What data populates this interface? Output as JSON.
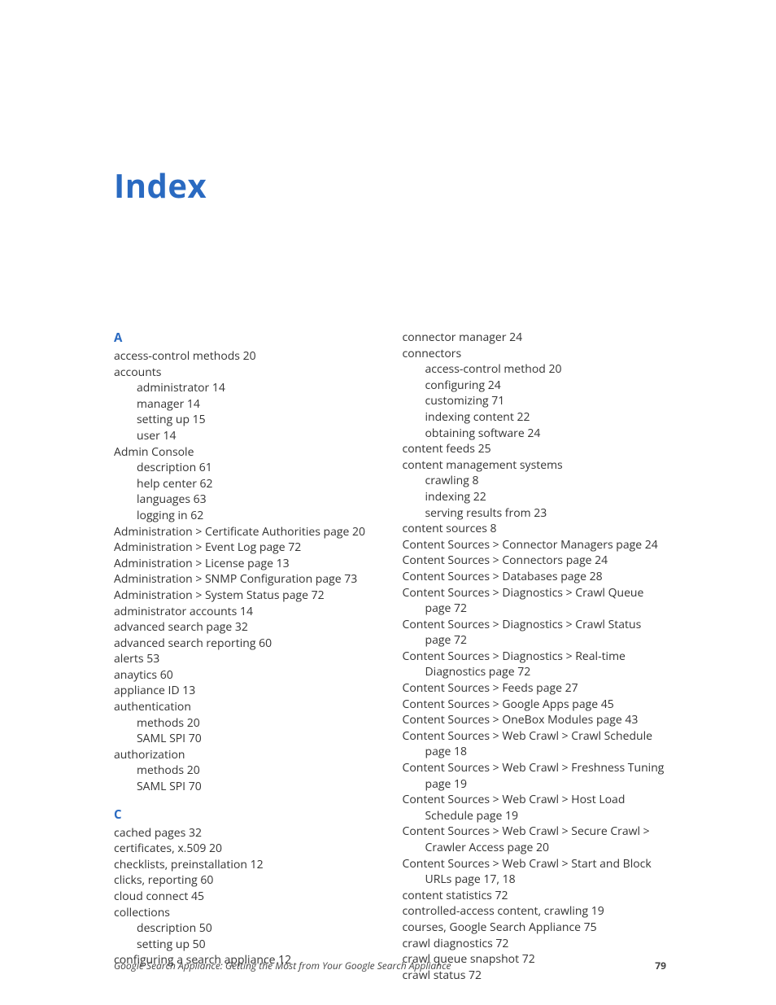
{
  "title": "Index",
  "footer": {
    "doc_title": "Google Search Appliance: Getting the Most from Your Google Search Appliance",
    "page_number": "79"
  },
  "sections": [
    {
      "letter": "A",
      "entries": [
        {
          "text": "access-control methods  20"
        },
        {
          "text": "accounts",
          "subs": [
            {
              "text": "administrator  14"
            },
            {
              "text": "manager  14"
            },
            {
              "text": "setting up  15"
            },
            {
              "text": "user  14"
            }
          ]
        },
        {
          "text": "Admin Console",
          "subs": [
            {
              "text": "description  61"
            },
            {
              "text": "help center  62"
            },
            {
              "text": "languages  63"
            },
            {
              "text": "logging in  62"
            }
          ]
        },
        {
          "text": "Administration > Certificate Authorities page  20"
        },
        {
          "text": "Administration > Event Log page  72"
        },
        {
          "text": "Administration > License page  13"
        },
        {
          "text": "Administration > SNMP Configuration page  73"
        },
        {
          "text": "Administration > System Status page  72"
        },
        {
          "text": "administrator accounts  14"
        },
        {
          "text": "advanced search page  32"
        },
        {
          "text": "advanced search reporting  60"
        },
        {
          "text": "alerts  53"
        },
        {
          "text": "anaytics  60"
        },
        {
          "text": "appliance ID  13"
        },
        {
          "text": "authentication",
          "subs": [
            {
              "text": "methods  20"
            },
            {
              "text": "SAML SPI  70"
            }
          ]
        },
        {
          "text": "authorization",
          "subs": [
            {
              "text": "methods  20"
            },
            {
              "text": "SAML SPI  70"
            }
          ]
        }
      ]
    },
    {
      "letter": "C",
      "entries": [
        {
          "text": "cached pages  32"
        },
        {
          "text": "certificates, x.509  20"
        },
        {
          "text": "checklists, preinstallation  12"
        },
        {
          "text": "clicks, reporting  60"
        },
        {
          "text": "cloud connect  45"
        },
        {
          "text": "collections",
          "subs": [
            {
              "text": "description  50"
            },
            {
              "text": "setting up  50"
            }
          ]
        },
        {
          "text": "configuring a search appliance  12"
        },
        {
          "text": "connector manager  24"
        },
        {
          "text": "connectors",
          "subs": [
            {
              "text": "access-control method  20"
            },
            {
              "text": "configuring  24"
            },
            {
              "text": "customizing  71"
            },
            {
              "text": "indexing content  22"
            },
            {
              "text": "obtaining software  24"
            }
          ]
        },
        {
          "text": "content feeds  25"
        },
        {
          "text": "content management systems",
          "subs": [
            {
              "text": "crawling  8"
            },
            {
              "text": "indexing  22"
            },
            {
              "text": "serving results from  23"
            }
          ]
        },
        {
          "text": "content sources  8"
        },
        {
          "text": "Content Sources > Connector Managers page  24"
        },
        {
          "text": "Content Sources > Connectors page  24"
        },
        {
          "text": "Content Sources > Databases page  28"
        },
        {
          "text": "Content Sources > Diagnostics > Crawl Queue page  72",
          "hang": true
        },
        {
          "text": "Content Sources > Diagnostics > Crawl Status page  72",
          "hang": true
        },
        {
          "text": "Content Sources > Diagnostics > Real-time Diagnostics page  72",
          "hang": true
        },
        {
          "text": "Content Sources > Feeds page  27"
        },
        {
          "text": "Content Sources > Google Apps page  45"
        },
        {
          "text": "Content Sources > OneBox Modules page  43"
        },
        {
          "text": "Content Sources > Web Crawl > Crawl Schedule page  18",
          "hang": true
        },
        {
          "text": "Content Sources > Web Crawl > Freshness Tuning page  19",
          "hang": true
        },
        {
          "text": "Content Sources > Web Crawl > Host Load Schedule page  19",
          "hang": true
        },
        {
          "text": "Content Sources > Web Crawl > Secure Crawl > Crawler Access page  20",
          "hang": true
        },
        {
          "text": "Content Sources > Web Crawl > Start and Block URLs page  17, 18",
          "hang": true
        },
        {
          "text": "content statistics  72"
        },
        {
          "text": "controlled-access content, crawling  19"
        },
        {
          "text": "courses, Google Search Appliance  75"
        },
        {
          "text": "crawl diagnostics  72"
        },
        {
          "text": "crawl queue snapshot  72"
        },
        {
          "text": "crawl status  72"
        }
      ]
    }
  ]
}
